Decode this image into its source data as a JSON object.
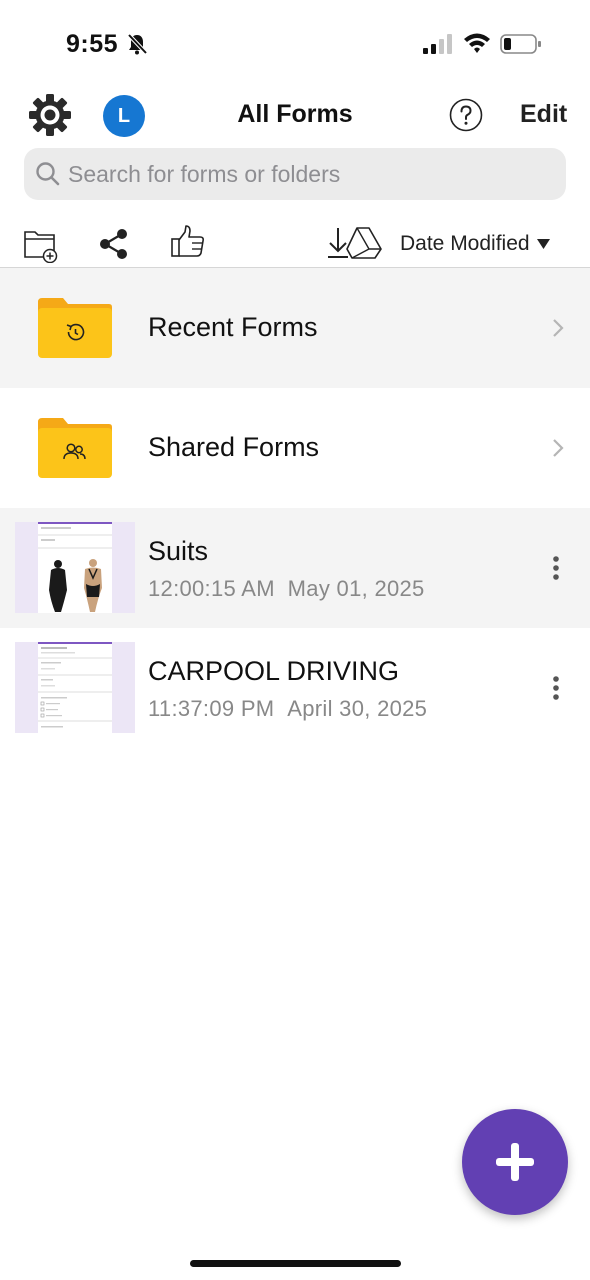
{
  "status_bar": {
    "time": "9:55",
    "icons": [
      "bell-slash-icon",
      "signal-icon",
      "wifi-icon",
      "battery-icon"
    ]
  },
  "header": {
    "title": "All Forms",
    "edit_label": "Edit",
    "avatar_initial": "L",
    "avatar_color": "#1677d2",
    "icons": [
      "gear-icon",
      "help-icon"
    ]
  },
  "search": {
    "placeholder": "Search for forms or folders",
    "value": ""
  },
  "toolbar": {
    "sort_label": "Date Modified",
    "icons": [
      "new-folder-icon",
      "share-icon",
      "thumbs-up-icon",
      "download-drive-icon",
      "caret-down-icon"
    ]
  },
  "folders": [
    {
      "title": "Recent Forms",
      "icon": "recent-folder-icon"
    },
    {
      "title": "Shared Forms",
      "icon": "shared-folder-icon"
    }
  ],
  "forms": [
    {
      "title": "Suits",
      "time": "12:00:15 AM",
      "date": "May 01, 2025"
    },
    {
      "title": "CARPOOL DRIVING",
      "time": "11:37:09 PM",
      "date": "April 30, 2025"
    }
  ],
  "colors": {
    "accent": "#6240b3",
    "folder": "#fcc419",
    "folder_tab": "#f5a917"
  }
}
